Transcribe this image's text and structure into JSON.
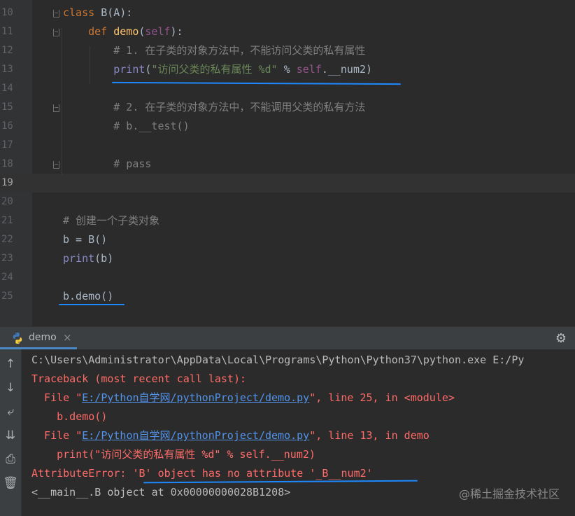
{
  "editor": {
    "lines": [
      {
        "num": "10",
        "tokens": [
          {
            "t": "class ",
            "c": "kw"
          },
          {
            "t": "B(A):",
            "c": ""
          }
        ]
      },
      {
        "num": "11",
        "tokens": [
          {
            "t": "    def ",
            "c": "kw"
          },
          {
            "t": "demo",
            "c": "fn"
          },
          {
            "t": "(",
            "c": ""
          },
          {
            "t": "self",
            "c": "self"
          },
          {
            "t": "):",
            "c": ""
          }
        ]
      },
      {
        "num": "12",
        "tokens": [
          {
            "t": "        # 1. 在子类的对象方法中，不能访问父类的私有属性",
            "c": "cm"
          }
        ]
      },
      {
        "num": "13",
        "tokens": [
          {
            "t": "        print",
            "c": "bi"
          },
          {
            "t": "(",
            "c": ""
          },
          {
            "t": "\"访问父类的私有属性 %d\"",
            "c": "str"
          },
          {
            "t": " % ",
            "c": ""
          },
          {
            "t": "self",
            "c": "self"
          },
          {
            "t": ".__num2)",
            "c": ""
          }
        ]
      },
      {
        "num": "14",
        "tokens": []
      },
      {
        "num": "15",
        "tokens": [
          {
            "t": "        # 2. 在子类的对象方法中，不能调用父类的私有方法",
            "c": "cm"
          }
        ]
      },
      {
        "num": "16",
        "tokens": [
          {
            "t": "        # b.__test()",
            "c": "cm"
          }
        ]
      },
      {
        "num": "17",
        "tokens": []
      },
      {
        "num": "18",
        "tokens": [
          {
            "t": "        # pass",
            "c": "cm"
          }
        ]
      },
      {
        "num": "19",
        "tokens": [],
        "current": true
      },
      {
        "num": "20",
        "tokens": []
      },
      {
        "num": "21",
        "tokens": [
          {
            "t": "# 创建一个子类对象",
            "c": "cm"
          }
        ]
      },
      {
        "num": "22",
        "tokens": [
          {
            "t": "b = B()",
            "c": ""
          }
        ]
      },
      {
        "num": "23",
        "tokens": [
          {
            "t": "print",
            "c": "bi"
          },
          {
            "t": "(b)",
            "c": ""
          }
        ]
      },
      {
        "num": "24",
        "tokens": []
      },
      {
        "num": "25",
        "tokens": [
          {
            "t": "b.demo()",
            "c": ""
          }
        ]
      }
    ]
  },
  "run_panel": {
    "tab_label": "demo",
    "close_glyph": "×",
    "settings_glyph": "⚙",
    "toolbar": [
      {
        "name": "up-arrow-icon",
        "glyph": "↑"
      },
      {
        "name": "down-arrow-icon",
        "glyph": "↓"
      },
      {
        "name": "soft-wrap-icon",
        "glyph": "⤶"
      },
      {
        "name": "scroll-to-end-icon",
        "glyph": "⇊"
      },
      {
        "name": "print-icon",
        "glyph": "⎙"
      },
      {
        "name": "trash-icon",
        "glyph": "🗑"
      }
    ],
    "console": [
      {
        "tokens": [
          {
            "t": "C:\\Users\\Administrator\\AppData\\Local\\Programs\\Python\\Python37\\python.exe E:/Py",
            "c": "out"
          }
        ]
      },
      {
        "tokens": [
          {
            "t": "Traceback (most recent call last):",
            "c": "err"
          }
        ]
      },
      {
        "tokens": [
          {
            "t": "  File \"",
            "c": "err"
          },
          {
            "t": "E:/Python自学网/pythonProject/demo.py",
            "c": "link"
          },
          {
            "t": "\", line 25, in <module>",
            "c": "err"
          }
        ]
      },
      {
        "tokens": [
          {
            "t": "    b.demo()",
            "c": "err"
          }
        ]
      },
      {
        "tokens": [
          {
            "t": "  File \"",
            "c": "err"
          },
          {
            "t": "E:/Python自学网/pythonProject/demo.py",
            "c": "link"
          },
          {
            "t": "\", line 13, in demo",
            "c": "err"
          }
        ]
      },
      {
        "tokens": [
          {
            "t": "    print(\"访问父类的私有属性 %d\" % self.__num2)",
            "c": "err"
          }
        ]
      },
      {
        "tokens": [
          {
            "t": "AttributeError: 'B' object has no attribute '_B__num2'",
            "c": "err"
          }
        ]
      },
      {
        "tokens": [
          {
            "t": "<__main__.B object at 0x00000000028B1208>",
            "c": "out"
          }
        ]
      }
    ],
    "watermark": "@稀土掘金技术社区"
  },
  "colors": {
    "accent": "#4a88c7",
    "underline": "#1e88ff",
    "error": "#ff6b68",
    "link": "#5394ec"
  }
}
